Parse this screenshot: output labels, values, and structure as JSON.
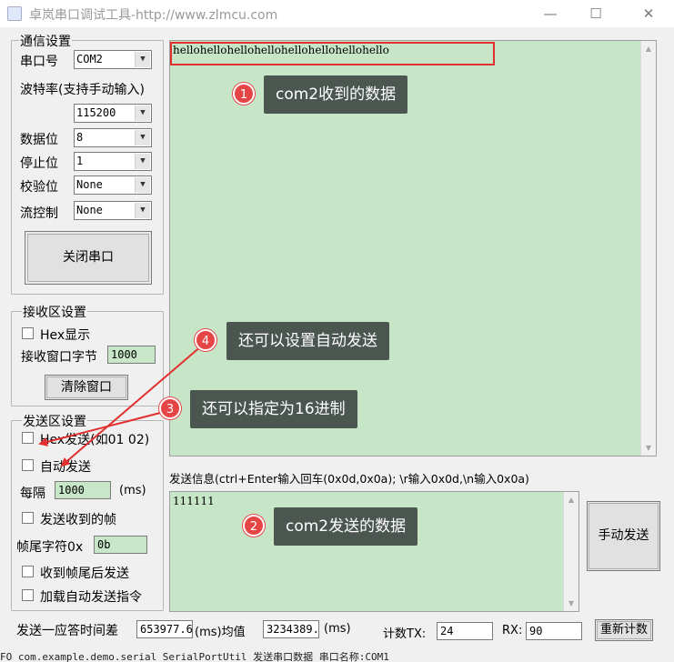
{
  "window": {
    "title": "卓岚串口调试工具-http://www.zlmcu.com",
    "minimize": "—",
    "maximize": "☐",
    "close": "✕"
  },
  "comm": {
    "group_label": "通信设置",
    "port_label": "串口号",
    "port_value": "COM2",
    "baud_label": "波特率(支持手动输入)",
    "baud_value": "115200",
    "databits_label": "数据位",
    "databits_value": "8",
    "stopbits_label": "停止位",
    "stopbits_value": "1",
    "parity_label": "校验位",
    "parity_value": "None",
    "flow_label": "流控制",
    "flow_value": "None",
    "close_port_button": "关闭串口"
  },
  "receive": {
    "group_label": "接收区设置",
    "hex_display": "Hex显示",
    "window_bytes_label": "接收窗口字节",
    "window_bytes_value": "1000",
    "clear_button": "清除窗口",
    "text": "hellohellohellohellohellohellohellohello"
  },
  "send": {
    "group_label": "发送区设置",
    "hex_send": "Hex发送(如01 02)",
    "auto_send": "自动发送",
    "interval_label": "每隔",
    "interval_value": "1000",
    "interval_unit": "(ms)",
    "send_received_frame": "发送收到的帧",
    "frame_tail_label": "帧尾字符0x",
    "frame_tail_value": "0b",
    "send_after_tail": "收到帧尾后发送",
    "load_auto_cmd": "加载自动发送指令",
    "info_label": "发送信息(ctrl+Enter输入回车(0x0d,0x0a); \\r输入0x0d,\\n输入0x0a)",
    "text": "111111",
    "manual_send_button": "手动发送"
  },
  "bottom": {
    "response_label": "发送一应答时间差",
    "response_value": "653977.6",
    "ms1": "(ms)均值",
    "avg_value": "3234389.",
    "ms2": "(ms)",
    "count_tx_label": "计数TX:",
    "count_tx_value": "24",
    "rx_label": "RX:",
    "rx_value": "90",
    "recount_button": "重新计数"
  },
  "status_bar": "FO com.example.demo.serial SerialPortUtil   发送串口数据  串口名称:COM1",
  "callouts": [
    {
      "num": "1",
      "text": "com2收到的数据"
    },
    {
      "num": "2",
      "text": "com2发送的数据"
    },
    {
      "num": "3",
      "text": "还可以指定为16进制"
    },
    {
      "num": "4",
      "text": "还可以设置自动发送"
    }
  ],
  "colors": {
    "text_area_bg": "#c7e6c7",
    "callout_bg": "#4c5650",
    "badge_red": "#e64545",
    "highlight_red": "#e23030"
  }
}
